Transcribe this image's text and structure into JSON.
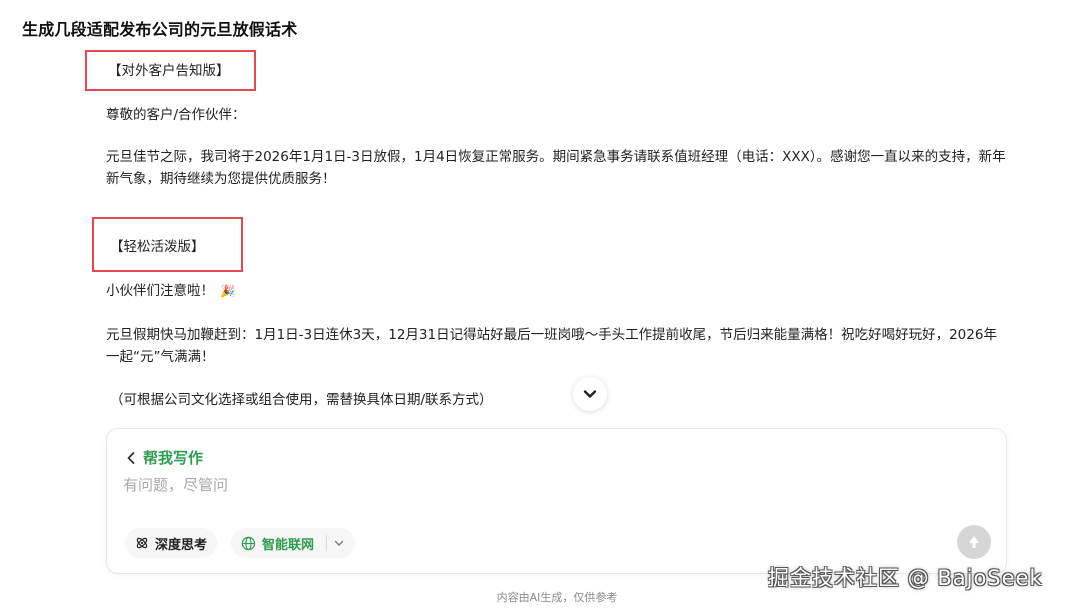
{
  "page": {
    "title": "生成几段适配发布公司的元旦放假话术",
    "disclaimer": "内容由AI生成，仅供参考"
  },
  "content": {
    "section1": {
      "heading": "【对外客户告知版】",
      "greeting": "尊敬的客户/合作伙伴：",
      "body": "元旦佳节之际，我司将于2026年1月1日-3日放假，1月4日恢复正常服务。期间紧急事务请联系值班经理（电话：XXX）。感谢您一直以来的支持，新年新气象，期待继续为您提供优质服务！"
    },
    "section2": {
      "heading": "【轻松活泼版】",
      "greeting": "小伙伴们注意啦！",
      "greeting_emoji": "🎉",
      "body": "元旦假期快马加鞭赶到：1月1日-3日连休3天，12月31日记得站好最后一班岗哦～手头工作提前收尾，节后归来能量满格！祝吃好喝好玩好，2026年一起“元”气满满！"
    },
    "note": "（可根据公司文化选择或组合使用，需替换具体日期/联系方式）"
  },
  "composer": {
    "mode_label": "帮我写作",
    "input_placeholder": "有问题，尽管问",
    "input_value": "",
    "deep_think_label": "深度思考",
    "web_search_label": "智能联网"
  },
  "watermark": "掘金技术社区 @ BajoSeek",
  "icons": {
    "scroll_down": "chevron-down-icon",
    "back": "chevron-left-icon",
    "deep_think": "atom-icon",
    "web_search": "globe-icon",
    "dropdown": "chevron-down-icon",
    "send": "arrow-up-icon"
  },
  "colors": {
    "highlight_box": "#e5484d",
    "accent_green": "#2f9d4f",
    "send_disabled": "#d6d6d6"
  }
}
